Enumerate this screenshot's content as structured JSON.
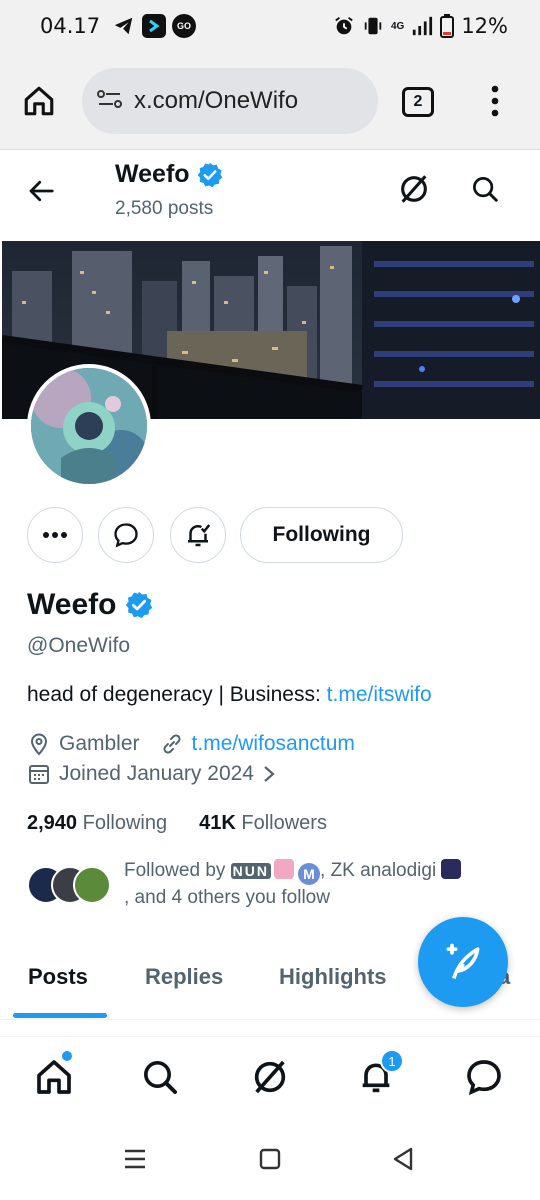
{
  "status_bar": {
    "time": "04.17",
    "battery": "12%",
    "network": "4G",
    "app_icons": [
      "telegram-icon",
      "prompt-app-icon",
      "go-app-icon"
    ],
    "system_icons": [
      "alarm-icon",
      "vibrate-icon",
      "signal-icon",
      "battery-icon"
    ]
  },
  "browser": {
    "url": "x.com/OneWifo",
    "tab_count": "2"
  },
  "header": {
    "name": "Weefo",
    "posts": "2,580 posts",
    "verified": true
  },
  "profile": {
    "name": "Weefo",
    "handle": "@OneWifo",
    "bio_text": "head of degeneracy | Business: ",
    "bio_link": "t.me/itswifo",
    "category": "Gambler",
    "website": "t.me/wifosanctum",
    "joined": "Joined January 2024",
    "following_count": "2,940",
    "following_label": "Following",
    "followers_count": "41K",
    "followers_label": "Followers",
    "followed_by_prefix": "Followed by ",
    "followed_by_names": "NUN",
    "followed_by_middle": ", ZK analodigi",
    "followed_by_suffix": ", and 4 others you follow",
    "following_button": "Following"
  },
  "tabs": [
    {
      "label": "Posts",
      "active": true
    },
    {
      "label": "Replies",
      "active": false
    },
    {
      "label": "Highlights",
      "active": false
    },
    {
      "label": "a",
      "active": false
    }
  ],
  "bottom_nav": {
    "items": [
      "home-icon",
      "search-icon",
      "grok-icon",
      "notifications-icon",
      "messages-icon"
    ],
    "notification_badge": "1"
  },
  "colors": {
    "accent": "#1d9bf0",
    "text": "#0f1419",
    "muted": "#536471"
  }
}
